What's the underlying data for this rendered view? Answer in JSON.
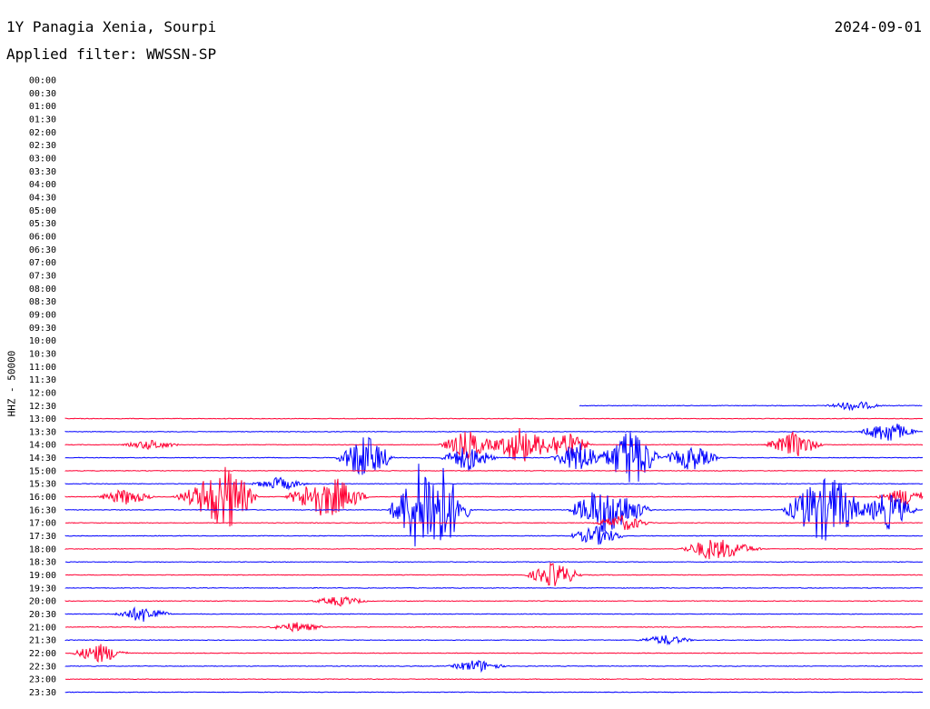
{
  "header": {
    "station": "1Y Panagia Xenia, Sourpi",
    "date": "2024-09-01",
    "filter": "Applied filter: WWSSN-SP"
  },
  "chart_data": {
    "type": "line",
    "ylabel": "HHZ - 50000",
    "row_labels": [
      "00:00",
      "00:30",
      "01:00",
      "01:30",
      "02:00",
      "02:30",
      "03:00",
      "03:30",
      "04:00",
      "04:30",
      "05:00",
      "05:30",
      "06:00",
      "06:30",
      "07:00",
      "07:30",
      "08:00",
      "08:30",
      "09:00",
      "09:30",
      "10:00",
      "10:30",
      "11:00",
      "11:30",
      "12:00",
      "12:30",
      "13:00",
      "13:30",
      "14:00",
      "14:30",
      "15:00",
      "15:30",
      "16:00",
      "16:30",
      "17:00",
      "17:30",
      "18:00",
      "18:30",
      "19:00",
      "19:30",
      "20:00",
      "20:30",
      "21:00",
      "21:30",
      "22:00",
      "22:30",
      "23:00",
      "23:30"
    ],
    "data_start_row": "12:30",
    "data_start_fraction": 0.6,
    "colors": [
      "#0000ff",
      "#ff0033"
    ],
    "events": [
      {
        "row": "12:30",
        "x": 0.92,
        "amp": 0.3
      },
      {
        "row": "13:30",
        "x": 0.96,
        "amp": 0.7
      },
      {
        "row": "14:00",
        "x": 0.1,
        "amp": 0.3
      },
      {
        "row": "14:00",
        "x": 0.47,
        "amp": 0.9
      },
      {
        "row": "14:00",
        "x": 0.53,
        "amp": 1.2
      },
      {
        "row": "14:00",
        "x": 0.58,
        "amp": 0.9
      },
      {
        "row": "14:00",
        "x": 0.85,
        "amp": 0.8
      },
      {
        "row": "14:30",
        "x": 0.35,
        "amp": 1.5
      },
      {
        "row": "14:30",
        "x": 0.47,
        "amp": 0.8
      },
      {
        "row": "14:30",
        "x": 0.6,
        "amp": 1.0
      },
      {
        "row": "14:30",
        "x": 0.66,
        "amp": 2.0
      },
      {
        "row": "14:30",
        "x": 0.73,
        "amp": 0.8
      },
      {
        "row": "15:30",
        "x": 0.25,
        "amp": 0.4
      },
      {
        "row": "16:00",
        "x": 0.07,
        "amp": 0.5
      },
      {
        "row": "16:00",
        "x": 0.16,
        "amp": 0.8
      },
      {
        "row": "16:00",
        "x": 0.19,
        "amp": 2.0
      },
      {
        "row": "16:00",
        "x": 0.29,
        "amp": 1.0
      },
      {
        "row": "16:00",
        "x": 0.32,
        "amp": 1.0
      },
      {
        "row": "16:00",
        "x": 0.98,
        "amp": 0.6
      },
      {
        "row": "16:30",
        "x": 0.41,
        "amp": 2.5
      },
      {
        "row": "16:30",
        "x": 0.44,
        "amp": 2.5
      },
      {
        "row": "16:30",
        "x": 0.62,
        "amp": 1.3
      },
      {
        "row": "16:30",
        "x": 0.65,
        "amp": 1.0
      },
      {
        "row": "16:30",
        "x": 0.87,
        "amp": 1.5
      },
      {
        "row": "16:30",
        "x": 0.9,
        "amp": 1.8
      },
      {
        "row": "16:30",
        "x": 0.96,
        "amp": 1.2
      },
      {
        "row": "17:00",
        "x": 0.65,
        "amp": 0.5
      },
      {
        "row": "17:30",
        "x": 0.62,
        "amp": 0.6
      },
      {
        "row": "18:00",
        "x": 0.75,
        "amp": 0.6
      },
      {
        "row": "18:00",
        "x": 0.78,
        "amp": 0.4
      },
      {
        "row": "19:00",
        "x": 0.57,
        "amp": 0.8
      },
      {
        "row": "20:00",
        "x": 0.32,
        "amp": 0.3
      },
      {
        "row": "20:30",
        "x": 0.09,
        "amp": 0.5
      },
      {
        "row": "21:00",
        "x": 0.27,
        "amp": 0.3
      },
      {
        "row": "21:30",
        "x": 0.7,
        "amp": 0.3
      },
      {
        "row": "22:00",
        "x": 0.04,
        "amp": 0.6
      },
      {
        "row": "22:30",
        "x": 0.48,
        "amp": 0.4
      }
    ]
  }
}
